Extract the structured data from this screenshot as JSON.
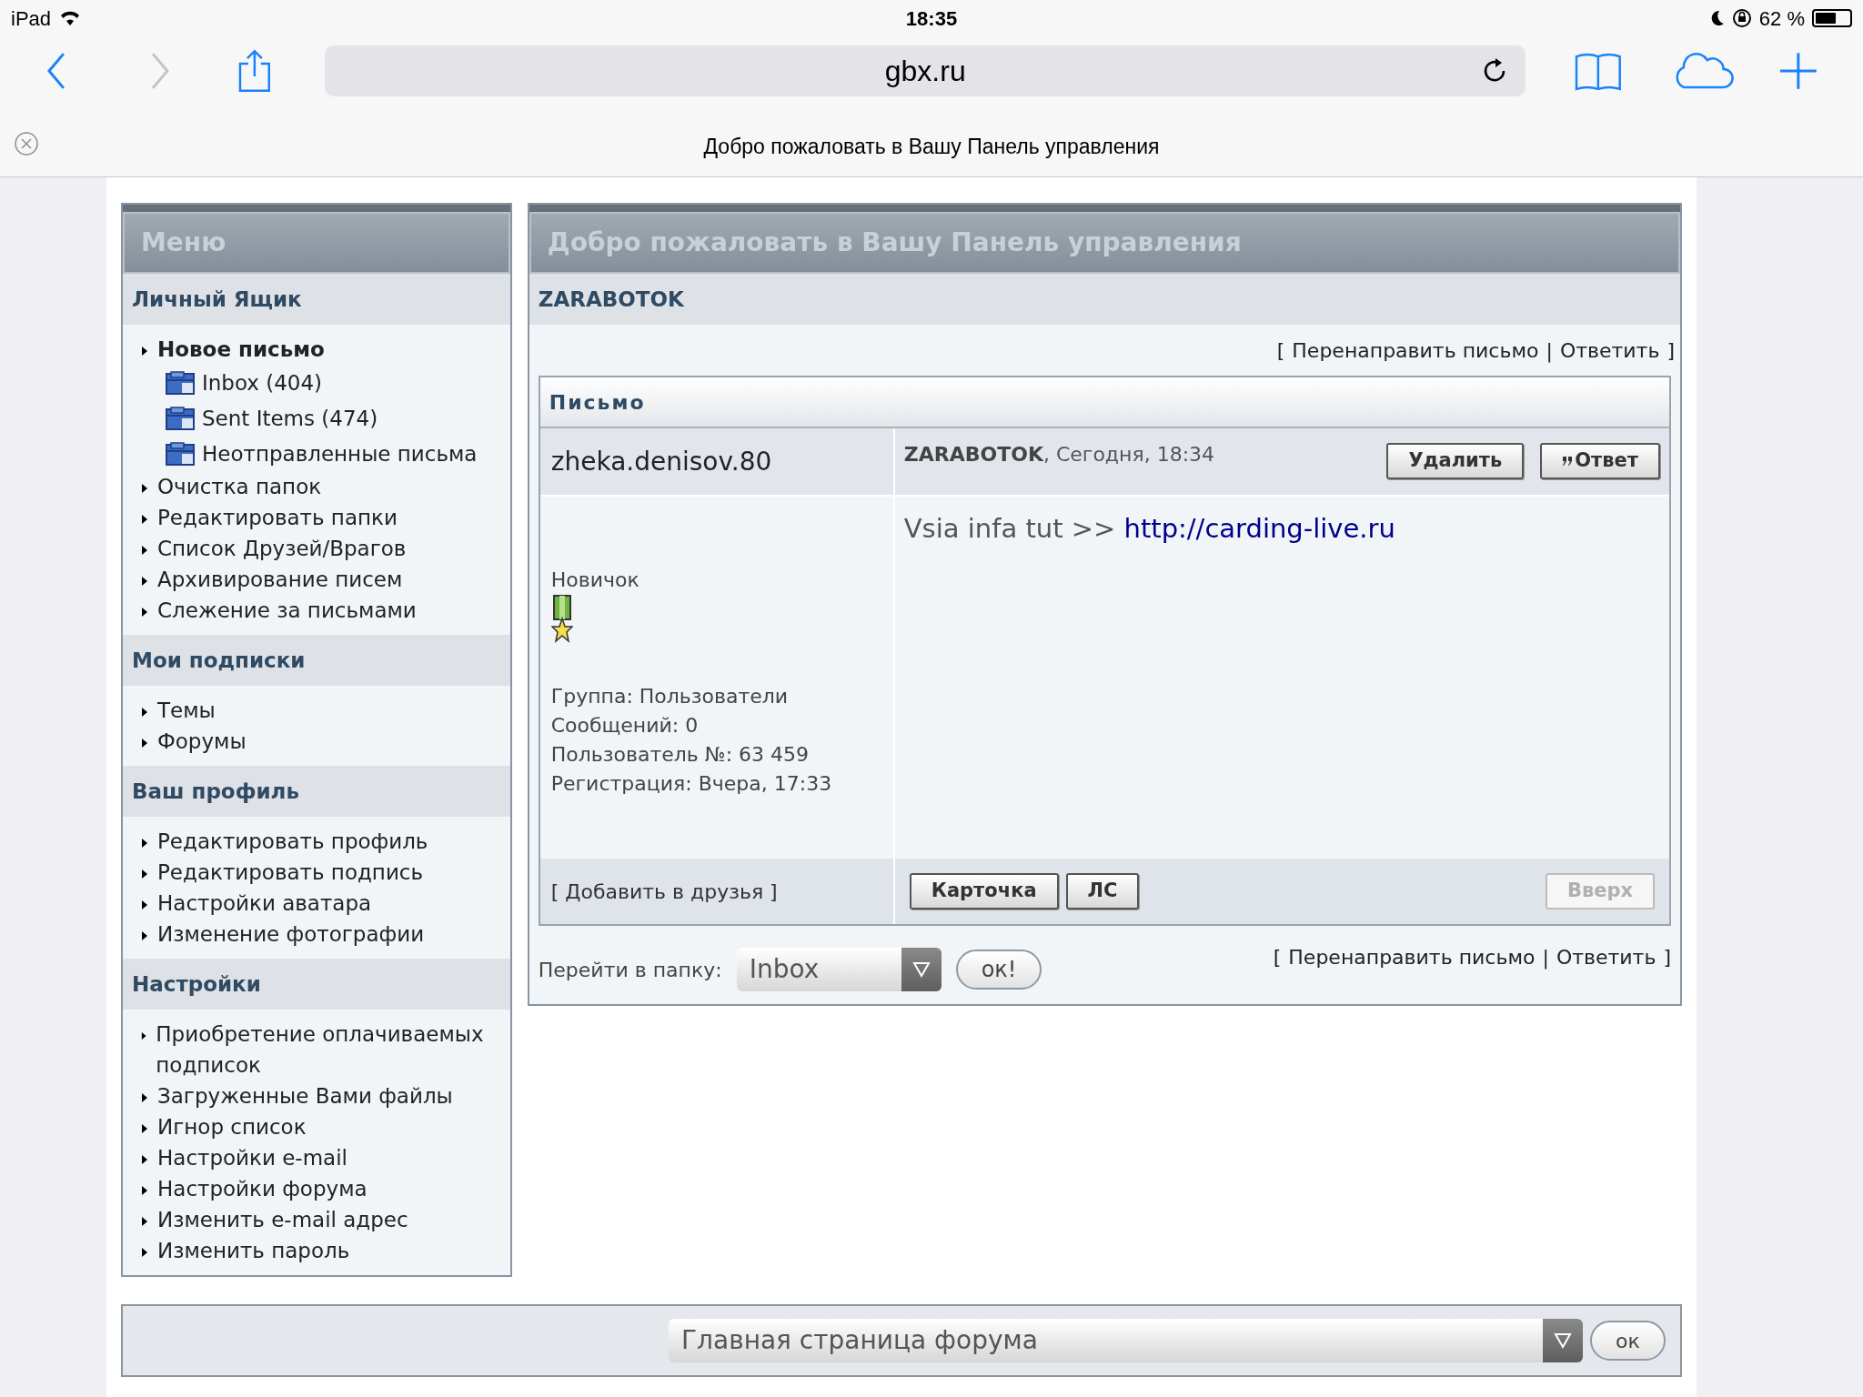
{
  "status_bar": {
    "device": "iPad",
    "time": "18:35",
    "battery": "62 %"
  },
  "browser": {
    "url": "gbx.ru",
    "page_title": "Добро пожаловать в Вашу Панель управления"
  },
  "menu": {
    "title": "Меню",
    "sections": [
      {
        "title": "Личный Ящик",
        "items": [
          {
            "kind": "bold",
            "label": "Новое письмо"
          },
          {
            "kind": "folder",
            "label": "Inbox (404)"
          },
          {
            "kind": "folder",
            "label": "Sent Items (474)"
          },
          {
            "kind": "folder",
            "label": "Неотправленные письма"
          },
          {
            "kind": "arrow",
            "label": "Очистка папок"
          },
          {
            "kind": "arrow",
            "label": "Редактировать папки"
          },
          {
            "kind": "arrow",
            "label": "Список Друзей/Врагов"
          },
          {
            "kind": "arrow",
            "label": "Архивирование писем"
          },
          {
            "kind": "arrow",
            "label": "Слежение за письмами"
          }
        ]
      },
      {
        "title": "Мои подписки",
        "items": [
          {
            "kind": "arrow",
            "label": "Темы"
          },
          {
            "kind": "arrow",
            "label": "Форумы"
          }
        ]
      },
      {
        "title": "Ваш профиль",
        "items": [
          {
            "kind": "arrow",
            "label": "Редактировать профиль"
          },
          {
            "kind": "arrow",
            "label": "Редактировать подпись"
          },
          {
            "kind": "arrow",
            "label": "Настройки аватара"
          },
          {
            "kind": "arrow",
            "label": "Изменение фотографии"
          }
        ]
      },
      {
        "title": "Настройки",
        "items": [
          {
            "kind": "arrow",
            "label": "Приобретение оплачиваемых подписок"
          },
          {
            "kind": "arrow",
            "label": "Загруженные Вами файлы"
          },
          {
            "kind": "arrow",
            "label": "Игнор список"
          },
          {
            "kind": "arrow",
            "label": "Настройки e-mail"
          },
          {
            "kind": "arrow",
            "label": "Настройки форума"
          },
          {
            "kind": "arrow",
            "label": "Изменить e-mail адрес"
          },
          {
            "kind": "arrow",
            "label": "Изменить пароль"
          }
        ]
      }
    ]
  },
  "main": {
    "title": "Добро пожаловать в Вашу Панель управления",
    "subject": "ZARABOTOK",
    "top_links": {
      "open": "[",
      "links": [
        "Перенаправить письмо",
        "Ответить"
      ],
      "separator": "|",
      "close": "]"
    },
    "message": {
      "title": "Письмо",
      "author": "zheka.denisov.80",
      "sender": "ZARABOTOK",
      "date": ", Сегодня, 18:34",
      "header_buttons": [
        {
          "kind": "plain",
          "label": "Удалить",
          "disabled": false
        },
        {
          "kind": "quote",
          "label": "Ответ",
          "disabled": false
        }
      ],
      "body_text": "Vsia infa tut >>",
      "body_link": "http://carding-live.ru",
      "rank": "Новичок",
      "details": [
        "Группа: Пользователи",
        "Сообщений: 0",
        "Пользователь №: 63 459",
        "Регистрация: Вчера, 17:33"
      ],
      "add_friend": "[ Добавить в друзья ]",
      "footer_buttons": [
        {
          "label": "Карточка",
          "disabled": false
        },
        {
          "label": "ЛС",
          "disabled": false
        },
        {
          "label": "Вверх",
          "disabled": true
        }
      ]
    },
    "folder_jump": {
      "label": "Перейти в папку:",
      "value": "Inbox",
      "button": "ок!"
    },
    "bottom_links": {
      "open": "[",
      "links": [
        "Перенаправить письмо",
        "Ответить"
      ],
      "separator": "|",
      "close": "]"
    }
  },
  "footer_bar": {
    "value": "Главная страница форума",
    "button": "ок"
  }
}
